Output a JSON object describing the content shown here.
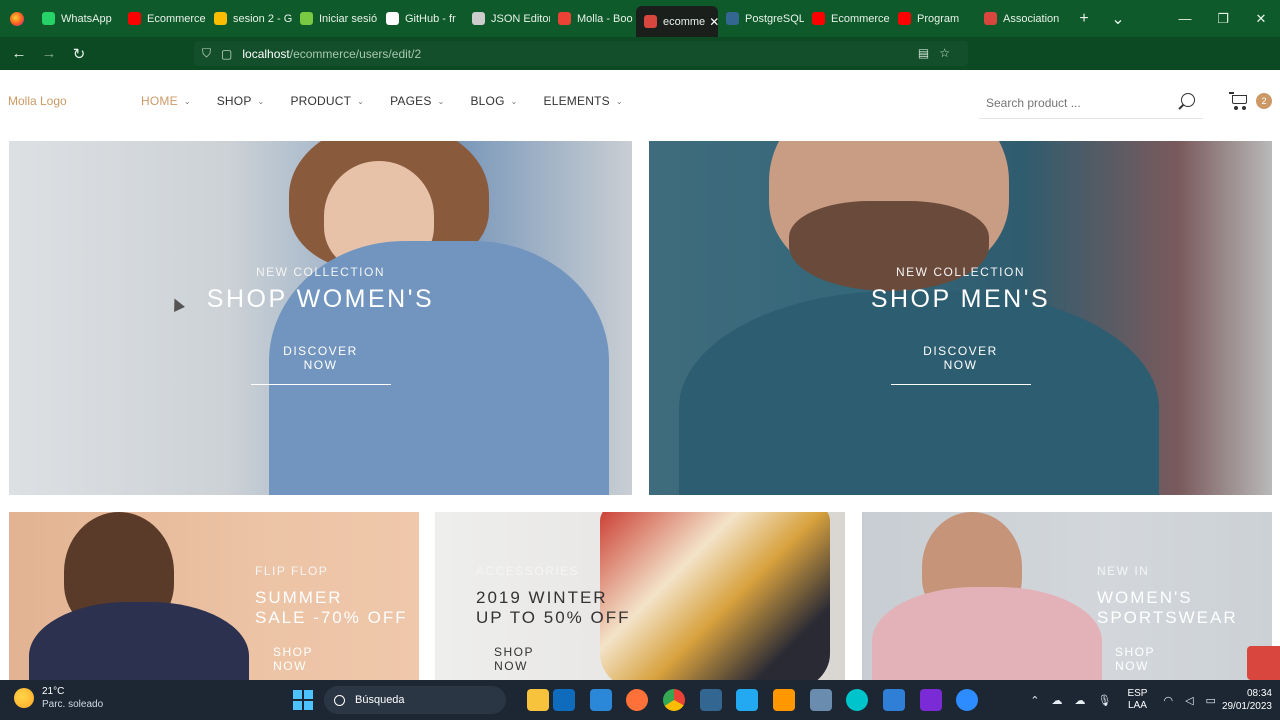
{
  "browser": {
    "tabs": [
      {
        "label": "WhatsApp",
        "color": "#25d366"
      },
      {
        "label": "Ecommerce",
        "color": "#ff0000"
      },
      {
        "label": "sesion 2 - G",
        "color": "#fbbc04"
      },
      {
        "label": "Iniciar sesió",
        "color": "#7ac943"
      },
      {
        "label": "GitHub - fr",
        "color": "#ffffff"
      },
      {
        "label": "JSON Editor",
        "color": "#cccccc"
      },
      {
        "label": "Molla - Boo",
        "color": "#ea4335"
      },
      {
        "label": "ecomme",
        "color": "#d9463e",
        "active": true
      },
      {
        "label": "PostgreSQL",
        "color": "#336791"
      },
      {
        "label": "Ecommerce",
        "color": "#ff0000"
      },
      {
        "label": "Program",
        "color": "#ff0000"
      },
      {
        "label": "Association",
        "color": "#d9463e"
      }
    ],
    "url_host": "localhost",
    "url_path": "/ecommerce/users/edit/2",
    "new_tab": "+",
    "list_tabs": "⌄"
  },
  "site": {
    "logo": "Molla Logo",
    "menu": [
      {
        "label": "HOME",
        "active": true
      },
      {
        "label": "SHOP"
      },
      {
        "label": "PRODUCT"
      },
      {
        "label": "PAGES"
      },
      {
        "label": "BLOG"
      },
      {
        "label": "ELEMENTS"
      }
    ],
    "search_placeholder": "Search product ...",
    "cart_count": "2",
    "accent": "#cc9966"
  },
  "banners": {
    "women": {
      "sub": "NEW COLLECTION",
      "title": "SHOP WOMEN'S",
      "cta": "DISCOVER NOW"
    },
    "men": {
      "sub": "NEW COLLECTION",
      "title": "SHOP MEN'S",
      "cta": "DISCOVER NOW"
    },
    "summer": {
      "sub": "FLIP FLOP",
      "title1": "SUMMER",
      "title2": "SALE -70% OFF",
      "cta": "SHOP NOW"
    },
    "accessories": {
      "sub": "ACCESSORIES",
      "title1": "2019 WINTER",
      "title2": "UP TO 50% OFF",
      "cta": "SHOP NOW"
    },
    "sportswear": {
      "sub": "NEW IN",
      "title1": "WOMEN'S",
      "title2": "SPORTSWEAR",
      "cta": "SHOP NOW"
    }
  },
  "taskbar": {
    "weather_temp": "21°C",
    "weather_desc": "Parc. soleado",
    "search_label": "Búsqueda",
    "lang1": "ESP",
    "lang2": "LAA",
    "time": "08:34",
    "date": "29/01/2023"
  }
}
